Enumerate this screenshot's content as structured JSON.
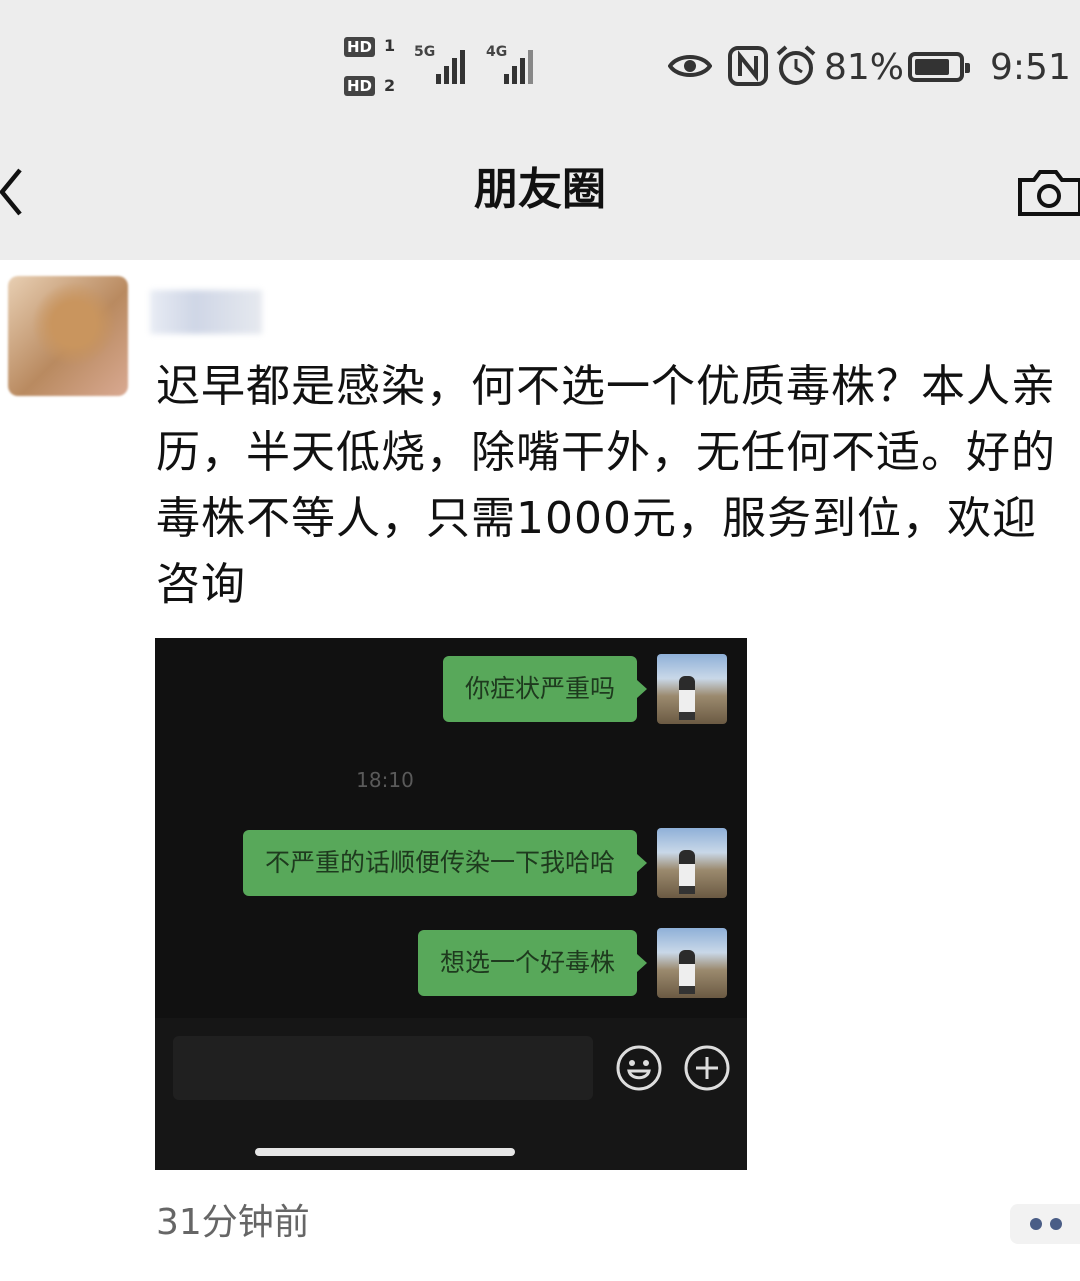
{
  "status_bar": {
    "sim1": "HD",
    "sim1_index": "1",
    "sim2": "HD",
    "sim2_index": "2",
    "network1": "5G",
    "network2": "4G",
    "battery_percent": "81%",
    "battery_level": 0.81,
    "time": "9:51",
    "icons": [
      "eye-icon",
      "nfc-icon",
      "alarm-icon"
    ]
  },
  "nav": {
    "title": "朋友圈",
    "back_icon": "chevron-left-icon",
    "camera_icon": "camera-icon"
  },
  "post": {
    "text": "迟早都是感染，何不选一个优质毒株？本人亲历，半天低烧，除嘴干外，无任何不适。好的毒株不等人，只需1000元，服务到位，欢迎咨询",
    "time": "31分钟前",
    "chat": {
      "messages": [
        {
          "text": "你症状严重吗"
        },
        {
          "text": "不严重的话顺便传染一下我哈哈"
        },
        {
          "text": "想选一个好毒株"
        }
      ],
      "timestamp": "18:10"
    }
  },
  "colors": {
    "nav_background": "#ededed",
    "bubble_green": "#58a85a",
    "chat_background": "#111111",
    "more_dots": "#4a5d86"
  }
}
